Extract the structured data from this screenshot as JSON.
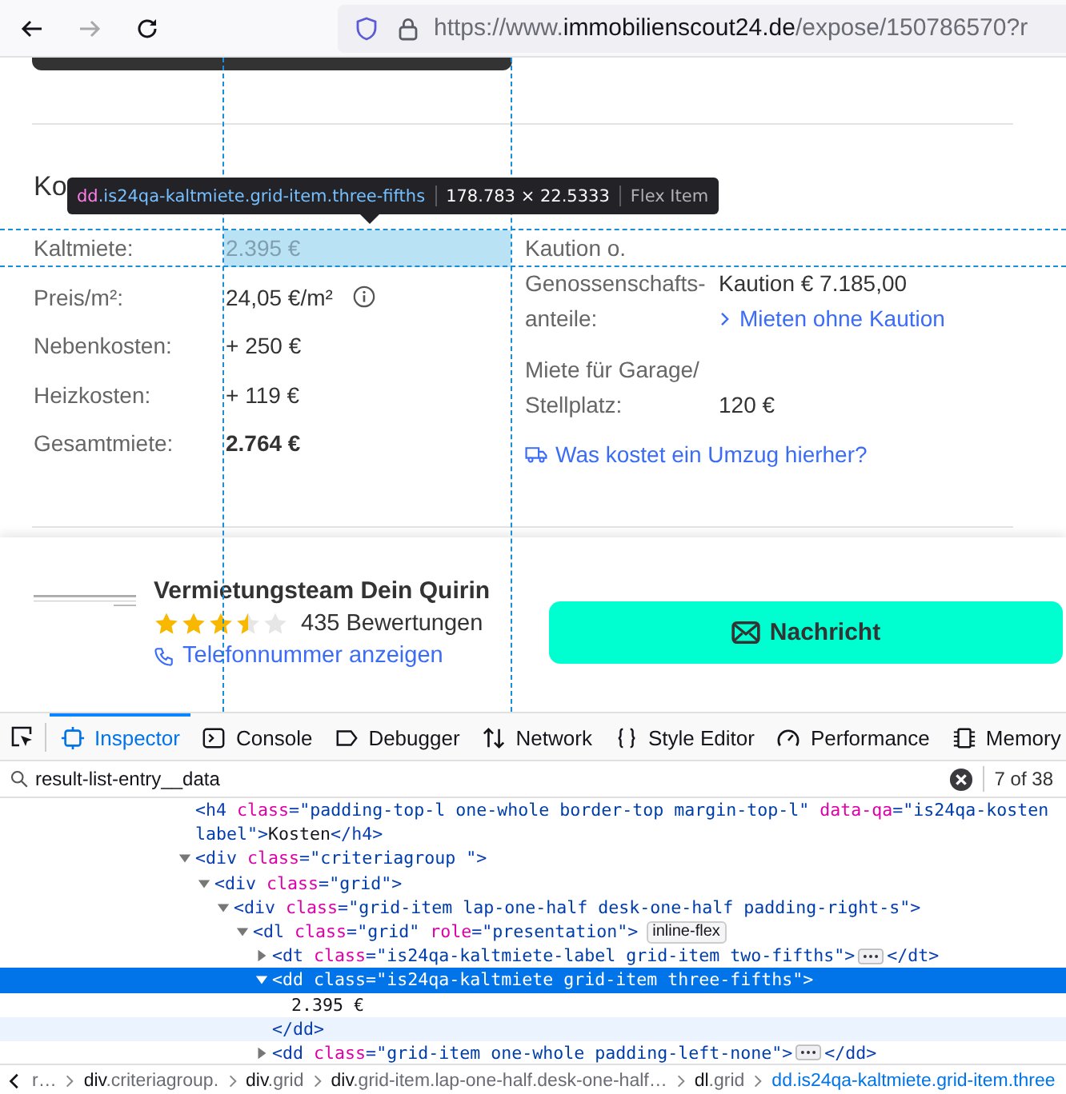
{
  "browser": {
    "url_scheme": "https://www.",
    "url_host": "immobilienscout24.de",
    "url_path": "/expose/150786570?r",
    "forward_disabled": true
  },
  "page": {
    "heading": "Ko",
    "tooltip": {
      "tag": "dd",
      "classes": ".is24qa-kaltmiete.grid-item.three-fifths",
      "size": "178.783 × 22.5333",
      "type": "Flex Item"
    },
    "costs": [
      {
        "label": "Kaltmiete:",
        "value": "2.395 €",
        "highlighted": true,
        "bold": false,
        "info": false
      },
      {
        "label": "Preis/m²:",
        "value": "24,05 €/m²",
        "highlighted": false,
        "bold": false,
        "info": true
      },
      {
        "label": "Nebenkosten:",
        "value": "+ 250 €",
        "highlighted": false,
        "bold": false,
        "info": false
      },
      {
        "label": "Heizkosten:",
        "value": "+ 119 €",
        "highlighted": false,
        "bold": false,
        "info": false
      },
      {
        "label": "Gesamtmiete:",
        "value": "2.764 €",
        "highlighted": false,
        "bold": true,
        "info": false
      }
    ],
    "side": [
      {
        "kind": "label",
        "label_lines": [
          "Kaution o."
        ]
      },
      {
        "kind": "pair",
        "label_lines": [
          "Genossenschafts-",
          "anteile:"
        ],
        "value": "Kaution € 7.185,00",
        "link": "Mieten ohne Kaution"
      },
      {
        "kind": "pair",
        "label_lines": [
          "Miete für Garage/",
          "Stellplatz:"
        ],
        "value": "120 €"
      },
      {
        "kind": "link",
        "text": "Was kostet ein Umzug hierher?"
      }
    ]
  },
  "contact": {
    "name": "Vermietungsteam Dein Quirin",
    "stars": 3.5,
    "reviews": "435 Bewertungen",
    "phone_link": "Telefonnummer anzeigen",
    "button": "Nachricht"
  },
  "devtools": {
    "tabs": [
      {
        "label": "Inspector",
        "selected": true
      },
      {
        "label": "Console",
        "selected": false
      },
      {
        "label": "Debugger",
        "selected": false
      },
      {
        "label": "Network",
        "selected": false
      },
      {
        "label": "Style Editor",
        "selected": false
      },
      {
        "label": "Performance",
        "selected": false
      },
      {
        "label": "Memory",
        "selected": false
      }
    ],
    "search": {
      "value": "result-list-entry__data",
      "count": "7 of 38"
    },
    "tree": [
      {
        "kind": "inline",
        "selected": false,
        "lines": [
          [
            {
              "kind": "punct",
              "text": "<"
            },
            {
              "kind": "tag",
              "text": "h4"
            },
            {
              "kind": "attr",
              "text": "class"
            },
            {
              "kind": "punct",
              "text": "="
            },
            {
              "kind": "val",
              "text": "\"padding-top-l one-whole border-top margin-top-l\""
            },
            {
              "kind": "attr",
              "text": "data-qa"
            },
            {
              "kind": "punct",
              "text": "="
            },
            {
              "kind": "val",
              "text": "\"is24qa-kosten"
            }
          ],
          [
            {
              "kind": "val",
              "text": "label\""
            },
            {
              "kind": "punct",
              "text": ">"
            },
            {
              "kind": "text",
              "text": "Kosten"
            },
            {
              "kind": "punct",
              "text": "</"
            },
            {
              "kind": "tag",
              "text": "h4"
            },
            {
              "kind": "punct",
              "text": ">"
            }
          ]
        ]
      },
      {
        "kind": "element",
        "expanded": true,
        "selected": false,
        "lines": [
          [
            {
              "kind": "punct",
              "text": "<"
            },
            {
              "kind": "tag",
              "text": "div"
            },
            {
              "kind": "attr",
              "text": "class"
            },
            {
              "kind": "punct",
              "text": "="
            },
            {
              "kind": "val",
              "text": "\"criteriagroup \""
            },
            {
              "kind": "punct",
              "text": ">"
            }
          ]
        ],
        "children": [
          {
            "kind": "element",
            "expanded": true,
            "selected": false,
            "lines": [
              [
                {
                  "kind": "punct",
                  "text": "<"
                },
                {
                  "kind": "tag",
                  "text": "div"
                },
                {
                  "kind": "attr",
                  "text": "class"
                },
                {
                  "kind": "punct",
                  "text": "="
                },
                {
                  "kind": "val",
                  "text": "\"grid\""
                },
                {
                  "kind": "punct",
                  "text": ">"
                }
              ]
            ],
            "children": [
              {
                "kind": "element",
                "expanded": true,
                "selected": false,
                "lines": [
                  [
                    {
                      "kind": "punct",
                      "text": "<"
                    },
                    {
                      "kind": "tag",
                      "text": "div"
                    },
                    {
                      "kind": "attr",
                      "text": "class"
                    },
                    {
                      "kind": "punct",
                      "text": "="
                    },
                    {
                      "kind": "val",
                      "text": "\"grid-item lap-one-half desk-one-half padding-right-s\""
                    },
                    {
                      "kind": "punct",
                      "text": ">"
                    }
                  ]
                ],
                "children": [
                  {
                    "kind": "element",
                    "expanded": true,
                    "selected": false,
                    "lines": [
                      [
                        {
                          "kind": "punct",
                          "text": "<"
                        },
                        {
                          "kind": "tag",
                          "text": "dl"
                        },
                        {
                          "kind": "attr",
                          "text": "class"
                        },
                        {
                          "kind": "punct",
                          "text": "="
                        },
                        {
                          "kind": "val",
                          "text": "\"grid\""
                        },
                        {
                          "kind": "attr",
                          "text": "role"
                        },
                        {
                          "kind": "punct",
                          "text": "="
                        },
                        {
                          "kind": "val",
                          "text": "\"presentation\""
                        },
                        {
                          "kind": "punct",
                          "text": ">"
                        },
                        {
                          "kind": "badge",
                          "text": "inline-flex"
                        }
                      ]
                    ],
                    "children": [
                      {
                        "kind": "element",
                        "expanded": false,
                        "selected": false,
                        "lines": [
                          [
                            {
                              "kind": "punct",
                              "text": "<"
                            },
                            {
                              "kind": "tag",
                              "text": "dt"
                            },
                            {
                              "kind": "attr",
                              "text": "class"
                            },
                            {
                              "kind": "punct",
                              "text": "="
                            },
                            {
                              "kind": "val",
                              "text": "\"is24qa-kaltmiete-label grid-item two-fifths\""
                            },
                            {
                              "kind": "punct",
                              "text": ">"
                            },
                            {
                              "kind": "more"
                            },
                            {
                              "kind": "punct",
                              "text": "</"
                            },
                            {
                              "kind": "tag",
                              "text": "dt"
                            },
                            {
                              "kind": "punct",
                              "text": ">"
                            }
                          ]
                        ]
                      },
                      {
                        "kind": "element",
                        "expanded": true,
                        "selected": true,
                        "lines": [
                          [
                            {
                              "kind": "punct",
                              "text": "<"
                            },
                            {
                              "kind": "tag",
                              "text": "dd"
                            },
                            {
                              "kind": "attr",
                              "text": "class"
                            },
                            {
                              "kind": "punct",
                              "text": "="
                            },
                            {
                              "kind": "val",
                              "text": "\"is24qa-kaltmiete grid-item three-fifths\""
                            },
                            {
                              "kind": "punct",
                              "text": ">"
                            }
                          ]
                        ],
                        "children": [
                          {
                            "kind": "text",
                            "selected": false,
                            "lines": [
                              [
                                {
                                  "kind": "text",
                                  "text": "2.395 €"
                                }
                              ]
                            ]
                          },
                          {
                            "kind": "close",
                            "selected": false,
                            "hovered": true,
                            "lines": [
                              [
                                {
                                  "kind": "punct",
                                  "text": "</"
                                },
                                {
                                  "kind": "tag",
                                  "text": "dd"
                                },
                                {
                                  "kind": "punct",
                                  "text": ">"
                                }
                              ]
                            ]
                          }
                        ]
                      },
                      {
                        "kind": "element",
                        "expanded": false,
                        "selected": false,
                        "lines": [
                          [
                            {
                              "kind": "punct",
                              "text": "<"
                            },
                            {
                              "kind": "tag",
                              "text": "dd"
                            },
                            {
                              "kind": "attr",
                              "text": "class"
                            },
                            {
                              "kind": "punct",
                              "text": "="
                            },
                            {
                              "kind": "val",
                              "text": "\"grid-item one-whole padding-left-none\""
                            },
                            {
                              "kind": "punct",
                              "text": ">"
                            },
                            {
                              "kind": "more"
                            },
                            {
                              "kind": "punct",
                              "text": "</"
                            },
                            {
                              "kind": "tag",
                              "text": "dd"
                            },
                            {
                              "kind": "punct",
                              "text": ">"
                            }
                          ]
                        ]
                      }
                    ]
                  }
                ]
              }
            ]
          }
        ]
      }
    ],
    "breadcrumbs": [
      {
        "cls": "r…",
        "selected": false
      },
      {
        "tag": "div",
        "cls": ".criteriagroup.",
        "selected": false
      },
      {
        "tag": "div",
        "cls": ".grid",
        "selected": false
      },
      {
        "tag": "div",
        "cls": ".grid-item.lap-one-half.desk-one-half…",
        "selected": false
      },
      {
        "tag": "dl",
        "cls": ".grid",
        "selected": false
      },
      {
        "tag": "dd",
        "cls": ".is24qa-kaltmiete.grid-item.three",
        "selected": true
      }
    ]
  }
}
